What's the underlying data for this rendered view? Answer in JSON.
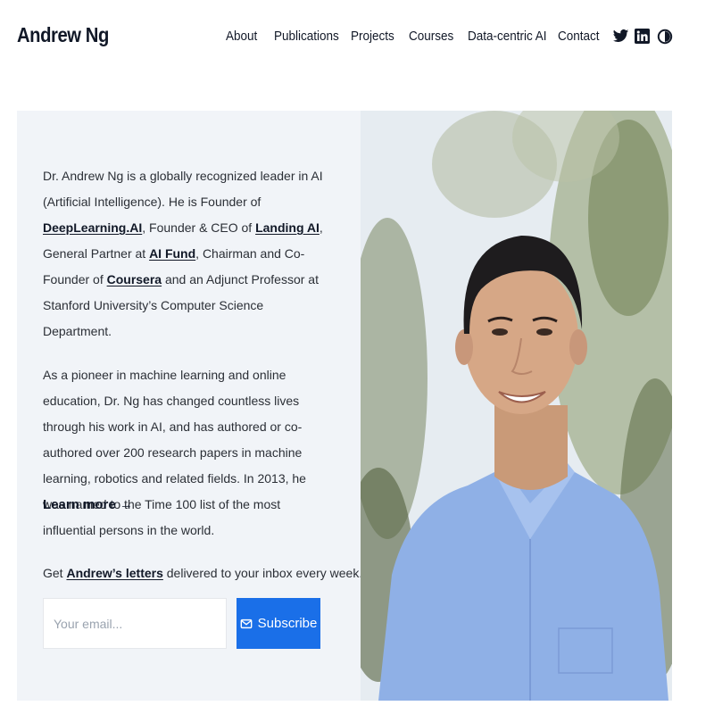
{
  "header": {
    "brand": "Andrew Ng",
    "nav": [
      "About",
      "Publications",
      "Projects",
      "Courses",
      "Data-centric AI",
      "Contact"
    ],
    "social_icons": [
      "twitter-icon",
      "linkedin-icon",
      "theme-toggle-icon"
    ]
  },
  "intro": {
    "p1_a": "Dr. Andrew Ng is a globally recognized leader in AI (Artificial Intelligence). He is Founder of ",
    "link_deeplearning": "DeepLearning.AI",
    "p1_b": ", Founder & CEO of ",
    "link_landing": "Landing AI",
    "p1_c": ", General Partner at ",
    "link_aifund": "AI Fund",
    "p1_d": ", Chairman and Co-Founder of ",
    "link_coursera": "Coursera",
    "p1_e": " and an Adjunct Professor at Stanford University’s Computer Science Department.",
    "p2": "As a pioneer in machine learning and online education, Dr. Ng has changed countless lives through his work in AI, and has authored or co-authored over 200 research papers in machine learning, robotics and related fields. In 2013, he was named to the Time 100 list of the most influential persons in the world."
  },
  "learn_more": "Learn more →",
  "newsletter": {
    "prefix": "Get ",
    "link": "Andrew’s letters",
    "suffix": " delivered to your inbox every week.",
    "placeholder": "Your email...",
    "button": "Subscribe"
  },
  "colors": {
    "accent": "#1a6fe8",
    "panel": "#f1f4f8",
    "text": "#111827"
  }
}
